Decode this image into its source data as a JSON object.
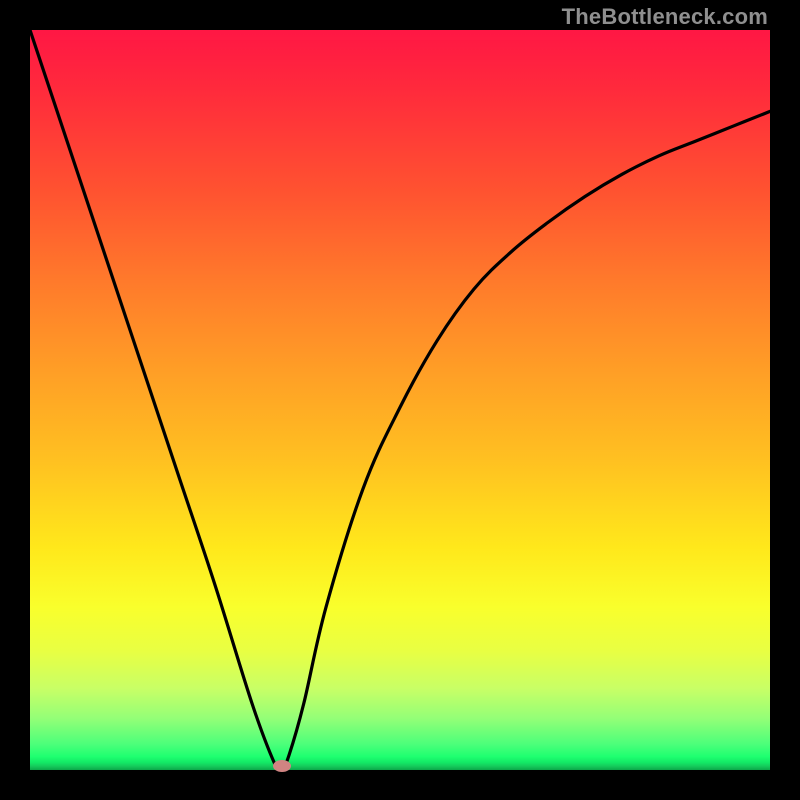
{
  "watermark": "TheBottleneck.com",
  "colors": {
    "frame": "#000000",
    "curve": "#000000",
    "marker": "#d08482"
  },
  "chart_data": {
    "type": "line",
    "title": "",
    "xlabel": "",
    "ylabel": "",
    "xlim": [
      0,
      100
    ],
    "ylim": [
      0,
      100
    ],
    "grid": false,
    "series": [
      {
        "name": "bottleneck-curve",
        "x": [
          0,
          5,
          10,
          15,
          20,
          25,
          30,
          33,
          34,
          35,
          37,
          40,
          45,
          50,
          55,
          60,
          65,
          70,
          75,
          80,
          85,
          90,
          95,
          100
        ],
        "values": [
          100,
          85,
          70,
          55,
          40,
          25,
          9,
          1,
          0,
          2,
          9,
          22,
          38,
          49,
          58,
          65,
          70,
          74,
          77.5,
          80.5,
          83,
          85,
          87,
          89
        ]
      }
    ],
    "markers": [
      {
        "name": "min-point",
        "x": 34,
        "y": 0
      }
    ],
    "background_gradient": {
      "top": "#ff1744",
      "bottom": "#0aa849"
    }
  }
}
